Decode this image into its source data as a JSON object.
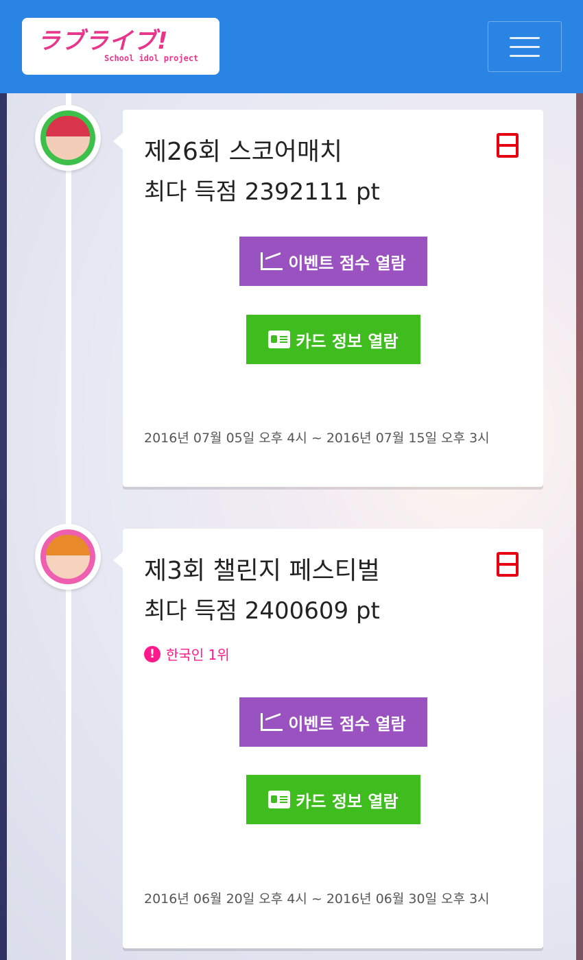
{
  "header": {
    "logo_jp": "ラブライブ!",
    "logo_en": "School idol project"
  },
  "events": [
    {
      "title": "제26회 스코어매치",
      "score": "최다 득점 2392111 pt",
      "notice": "",
      "score_button": "이벤트 점수 열람",
      "card_button": "카드 정보 열람",
      "date": "2016년 07월 05일 오후 4시 ~ 2016년 07월 15일 오후 3시"
    },
    {
      "title": "제3회 챌린지 페스티벌",
      "score": "최다 득점 2400609 pt",
      "notice": "한국인 1위",
      "score_button": "이벤트 점수 열람",
      "card_button": "카드 정보 열람",
      "date": "2016년 06월 20일 오후 4시 ~ 2016년 06월 30일 오후 3시"
    }
  ],
  "colors": {
    "header": "#2a84e3",
    "purple_button": "#9b52c1",
    "green_button": "#3fbc1e",
    "notice": "#ff1a8c",
    "bookmark": "#e50012"
  },
  "icons": {
    "menu": "hamburger-icon",
    "bookmark": "bookmark-icon",
    "score": "line-chart-icon",
    "card": "id-card-icon",
    "notice": "exclamation-circle-icon"
  }
}
